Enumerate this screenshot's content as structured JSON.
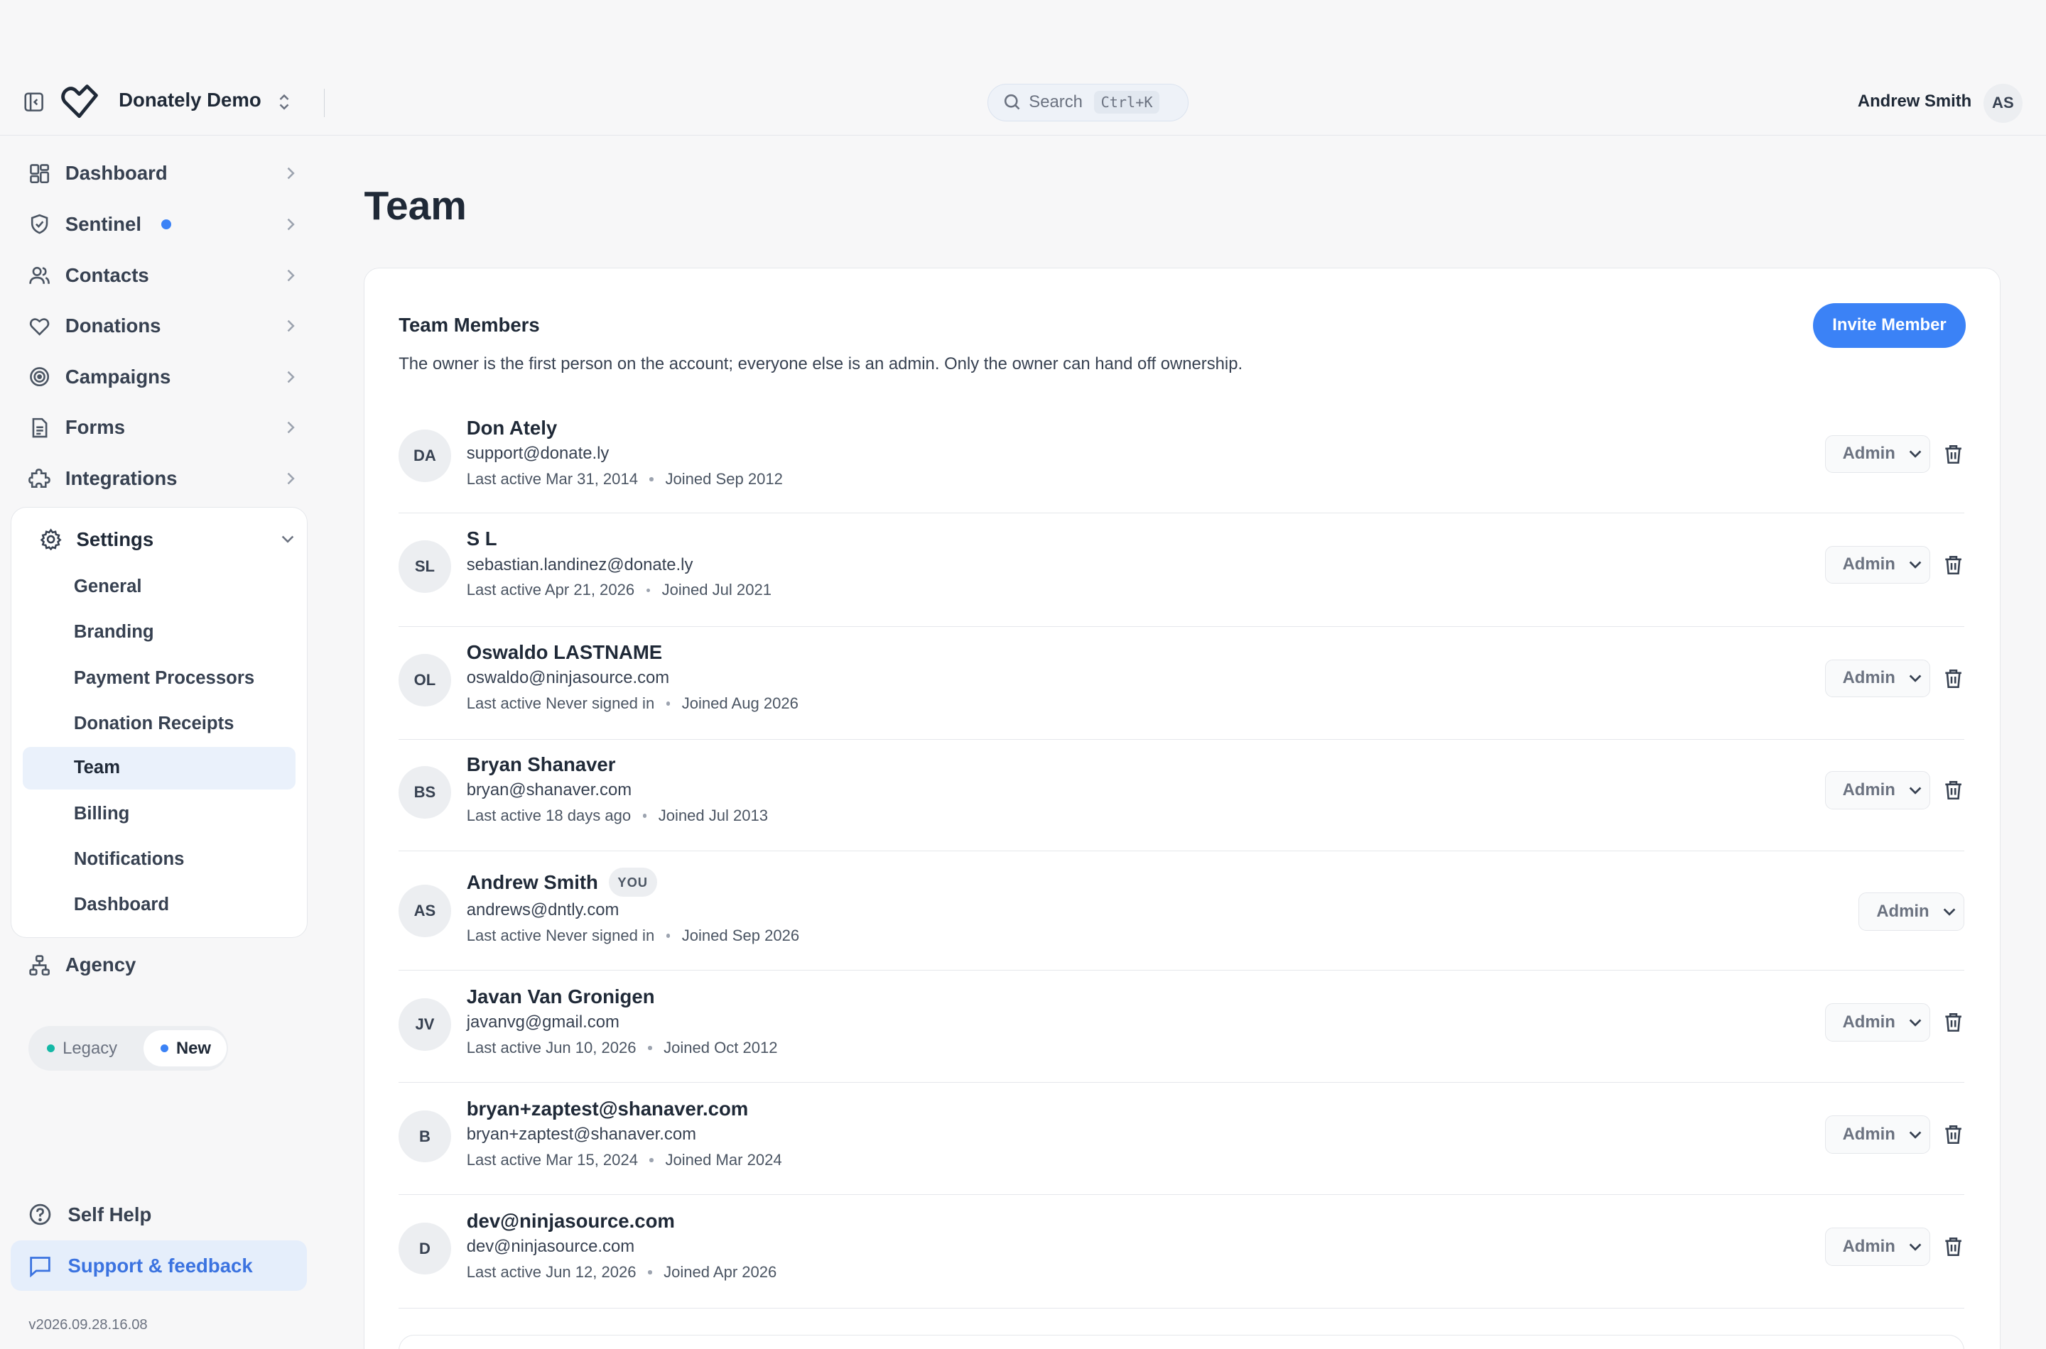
{
  "header": {
    "org_name": "Donately Demo",
    "search_label": "Search",
    "search_shortcut": "Ctrl+K",
    "user_name": "Andrew Smith",
    "user_initials": "AS"
  },
  "sidebar": {
    "items": [
      {
        "label": "Dashboard",
        "icon": "dashboard-icon"
      },
      {
        "label": "Sentinel",
        "icon": "shield-icon"
      },
      {
        "label": "Contacts",
        "icon": "users-icon"
      },
      {
        "label": "Donations",
        "icon": "heart-icon"
      },
      {
        "label": "Campaigns",
        "icon": "target-icon"
      },
      {
        "label": "Forms",
        "icon": "document-icon"
      },
      {
        "label": "Integrations",
        "icon": "puzzle-icon"
      }
    ],
    "settings": {
      "label": "Settings",
      "items": [
        "General",
        "Branding",
        "Payment Processors",
        "Donation Receipts",
        "Team",
        "Billing",
        "Notifications",
        "Dashboard"
      ],
      "active": "Team"
    },
    "agency_label": "Agency",
    "toggle": {
      "legacy": "Legacy",
      "new": "New",
      "selected": "New"
    },
    "self_help": "Self Help",
    "support": "Support & feedback",
    "version": "v2026.09.28.16.08"
  },
  "main": {
    "title": "Team",
    "card_title": "Team Members",
    "card_desc": "The owner is the first person on the account; everyone else is an admin. Only the owner can hand off ownership.",
    "invite_label": "Invite Member",
    "members": [
      {
        "initials": "DA",
        "name": "Don Ately",
        "email": "support@donate.ly",
        "last_active": "Last active Mar 31, 2014",
        "joined": "Joined Sep 2012",
        "role": "Admin",
        "you": false
      },
      {
        "initials": "SL",
        "name": "S L",
        "email": "sebastian.landinez@donate.ly",
        "last_active": "Last active Apr 21, 2026",
        "joined": "Joined Jul 2021",
        "role": "Admin",
        "you": false
      },
      {
        "initials": "OL",
        "name": "Oswaldo LASTNAME",
        "email": "oswaldo@ninjasource.com",
        "last_active": "Last active Never signed in",
        "joined": "Joined Aug 2026",
        "role": "Admin",
        "you": false
      },
      {
        "initials": "BS",
        "name": "Bryan Shanaver",
        "email": "bryan@shanaver.com",
        "last_active": "Last active 18 days ago",
        "joined": "Joined Jul 2013",
        "role": "Admin",
        "you": false
      },
      {
        "initials": "AS",
        "name": "Andrew Smith",
        "email": "andrews@dntly.com",
        "last_active": "Last active Never signed in",
        "joined": "Joined Sep 2026",
        "role": "Admin",
        "you": true,
        "you_label": "YOU"
      },
      {
        "initials": "JV",
        "name": "Javan Van Gronigen",
        "email": "javanvg@gmail.com",
        "last_active": "Last active Jun 10, 2026",
        "joined": "Joined Oct 2012",
        "role": "Admin",
        "you": false
      },
      {
        "initials": "B",
        "name": "bryan+zaptest@shanaver.com",
        "email": "bryan+zaptest@shanaver.com",
        "last_active": "Last active Mar 15, 2024",
        "joined": "Joined Mar 2024",
        "role": "Admin",
        "you": false
      },
      {
        "initials": "D",
        "name": "dev@ninjasource.com",
        "email": "dev@ninjasource.com",
        "last_active": "Last active Jun 12, 2026",
        "joined": "Joined Apr 2026",
        "role": "Admin",
        "you": false
      }
    ]
  },
  "colors": {
    "accent": "#3b82f6",
    "active_bg": "#eaf1fb",
    "text": "#1f2937"
  }
}
